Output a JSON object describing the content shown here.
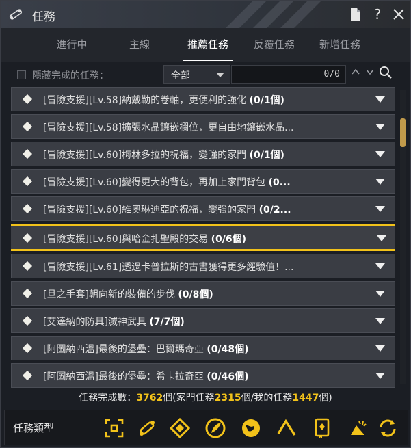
{
  "window": {
    "title": "任務"
  },
  "tabs": [
    {
      "label": "進行中"
    },
    {
      "label": "主線"
    },
    {
      "label": "推薦任務"
    },
    {
      "label": "反覆任務"
    },
    {
      "label": "新增任務"
    }
  ],
  "active_tab": "推薦任務",
  "filter": {
    "hide_completed_label": "隱藏完成的任務：",
    "category_select": "全部",
    "search_value": "",
    "search_count": "0/0"
  },
  "quests": [
    {
      "name": "[冒險支援][Lv.58]納戴勒的卷軸，更便利的強化",
      "progress": "(0/1個)"
    },
    {
      "name": "[冒險支援][Lv.58]擴張水晶鑲嵌欄位，更自由地鑲嵌水晶...",
      "progress": ""
    },
    {
      "name": "[冒險支援][Lv.60]梅林多拉的祝福，變強的家門",
      "progress": "(0/1個)"
    },
    {
      "name": "[冒險支援][Lv.60]變得更大的背包，再加上家門背包",
      "progress": "(0..."
    },
    {
      "name": "[冒險支援][Lv.60]維奧琳迪亞的祝福，變強的家門",
      "progress": "(0/2..."
    },
    {
      "name": "[冒險支援][Lv.60]與哈金扎聖殿的交易",
      "progress": "(0/6個)"
    },
    {
      "name": "[冒險支援][Lv.61]透過卡普拉斯的古書獲得更多經驗值！...",
      "progress": ""
    },
    {
      "name": "[旦之手套]朝向新的裝備的步伐",
      "progress": "(0/8個)"
    },
    {
      "name": "[艾達納的防具]滅神武具",
      "progress": "(7/7個)"
    },
    {
      "name": "[阿圖納西溫]最後的堡壘：巴爾瑪奇亞",
      "progress": "(0/48個)"
    },
    {
      "name": "[阿圖納西溫]最後的堡壘：希卡拉奇亞",
      "progress": "(0/46個)"
    }
  ],
  "highlighted_quest_index": 5,
  "stats": {
    "prefix": "任務完成數：",
    "total": "3762",
    "mid1": "個(家門任務",
    "family": "2315",
    "mid2": "個/我的任務",
    "mine": "1447",
    "suffix": "個)"
  },
  "footer": {
    "label": "任務類型",
    "icons": [
      "target-frame-icon",
      "scroll-map-icon",
      "diamond-path-icon",
      "feather-emblem-icon",
      "globe-icon",
      "pickaxe-icon",
      "book-icon",
      "whistle-icon",
      "refresh-icon"
    ]
  },
  "colors": {
    "accent": "#f2c21a",
    "item_bg": "#3a3d44",
    "window_bg": "#1b1e24"
  }
}
